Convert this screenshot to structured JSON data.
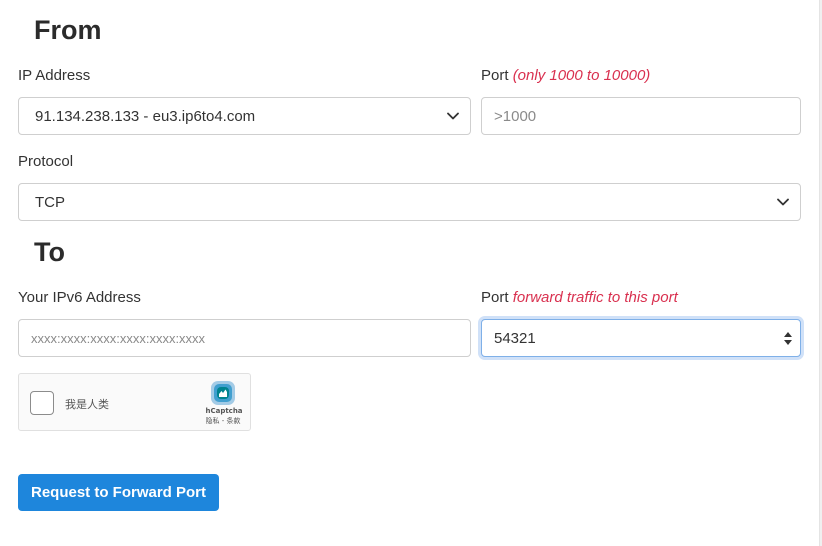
{
  "from": {
    "title": "From",
    "ip_address": {
      "label": "IP Address",
      "selected": "91.134.238.133 - eu3.ip6to4.com"
    },
    "port": {
      "label": "Port",
      "hint": "(only 1000 to 10000)",
      "placeholder": ">1000"
    },
    "protocol": {
      "label": "Protocol",
      "selected": "TCP"
    }
  },
  "to": {
    "title": "To",
    "ipv6": {
      "label": "Your IPv6 Address",
      "placeholder": "xxxx:xxxx:xxxx:xxxx:xxxx:xxxx"
    },
    "port": {
      "label": "Port",
      "hint": "forward traffic to this port",
      "value": "54321"
    }
  },
  "captcha": {
    "checkbox_label": "我是人类",
    "brand": "hCaptcha",
    "links": "隐私 - 条款"
  },
  "submit": {
    "label": "Request to Forward Port"
  },
  "colors": {
    "accent": "#1e86dc",
    "hint": "#d9304f",
    "focus_border": "#7fb0e8"
  },
  "icons": {
    "select_arrow": "chevron-down-icon",
    "spinner": "spinner-arrows-icon",
    "captcha_logo": "hcaptcha-logo-icon"
  }
}
